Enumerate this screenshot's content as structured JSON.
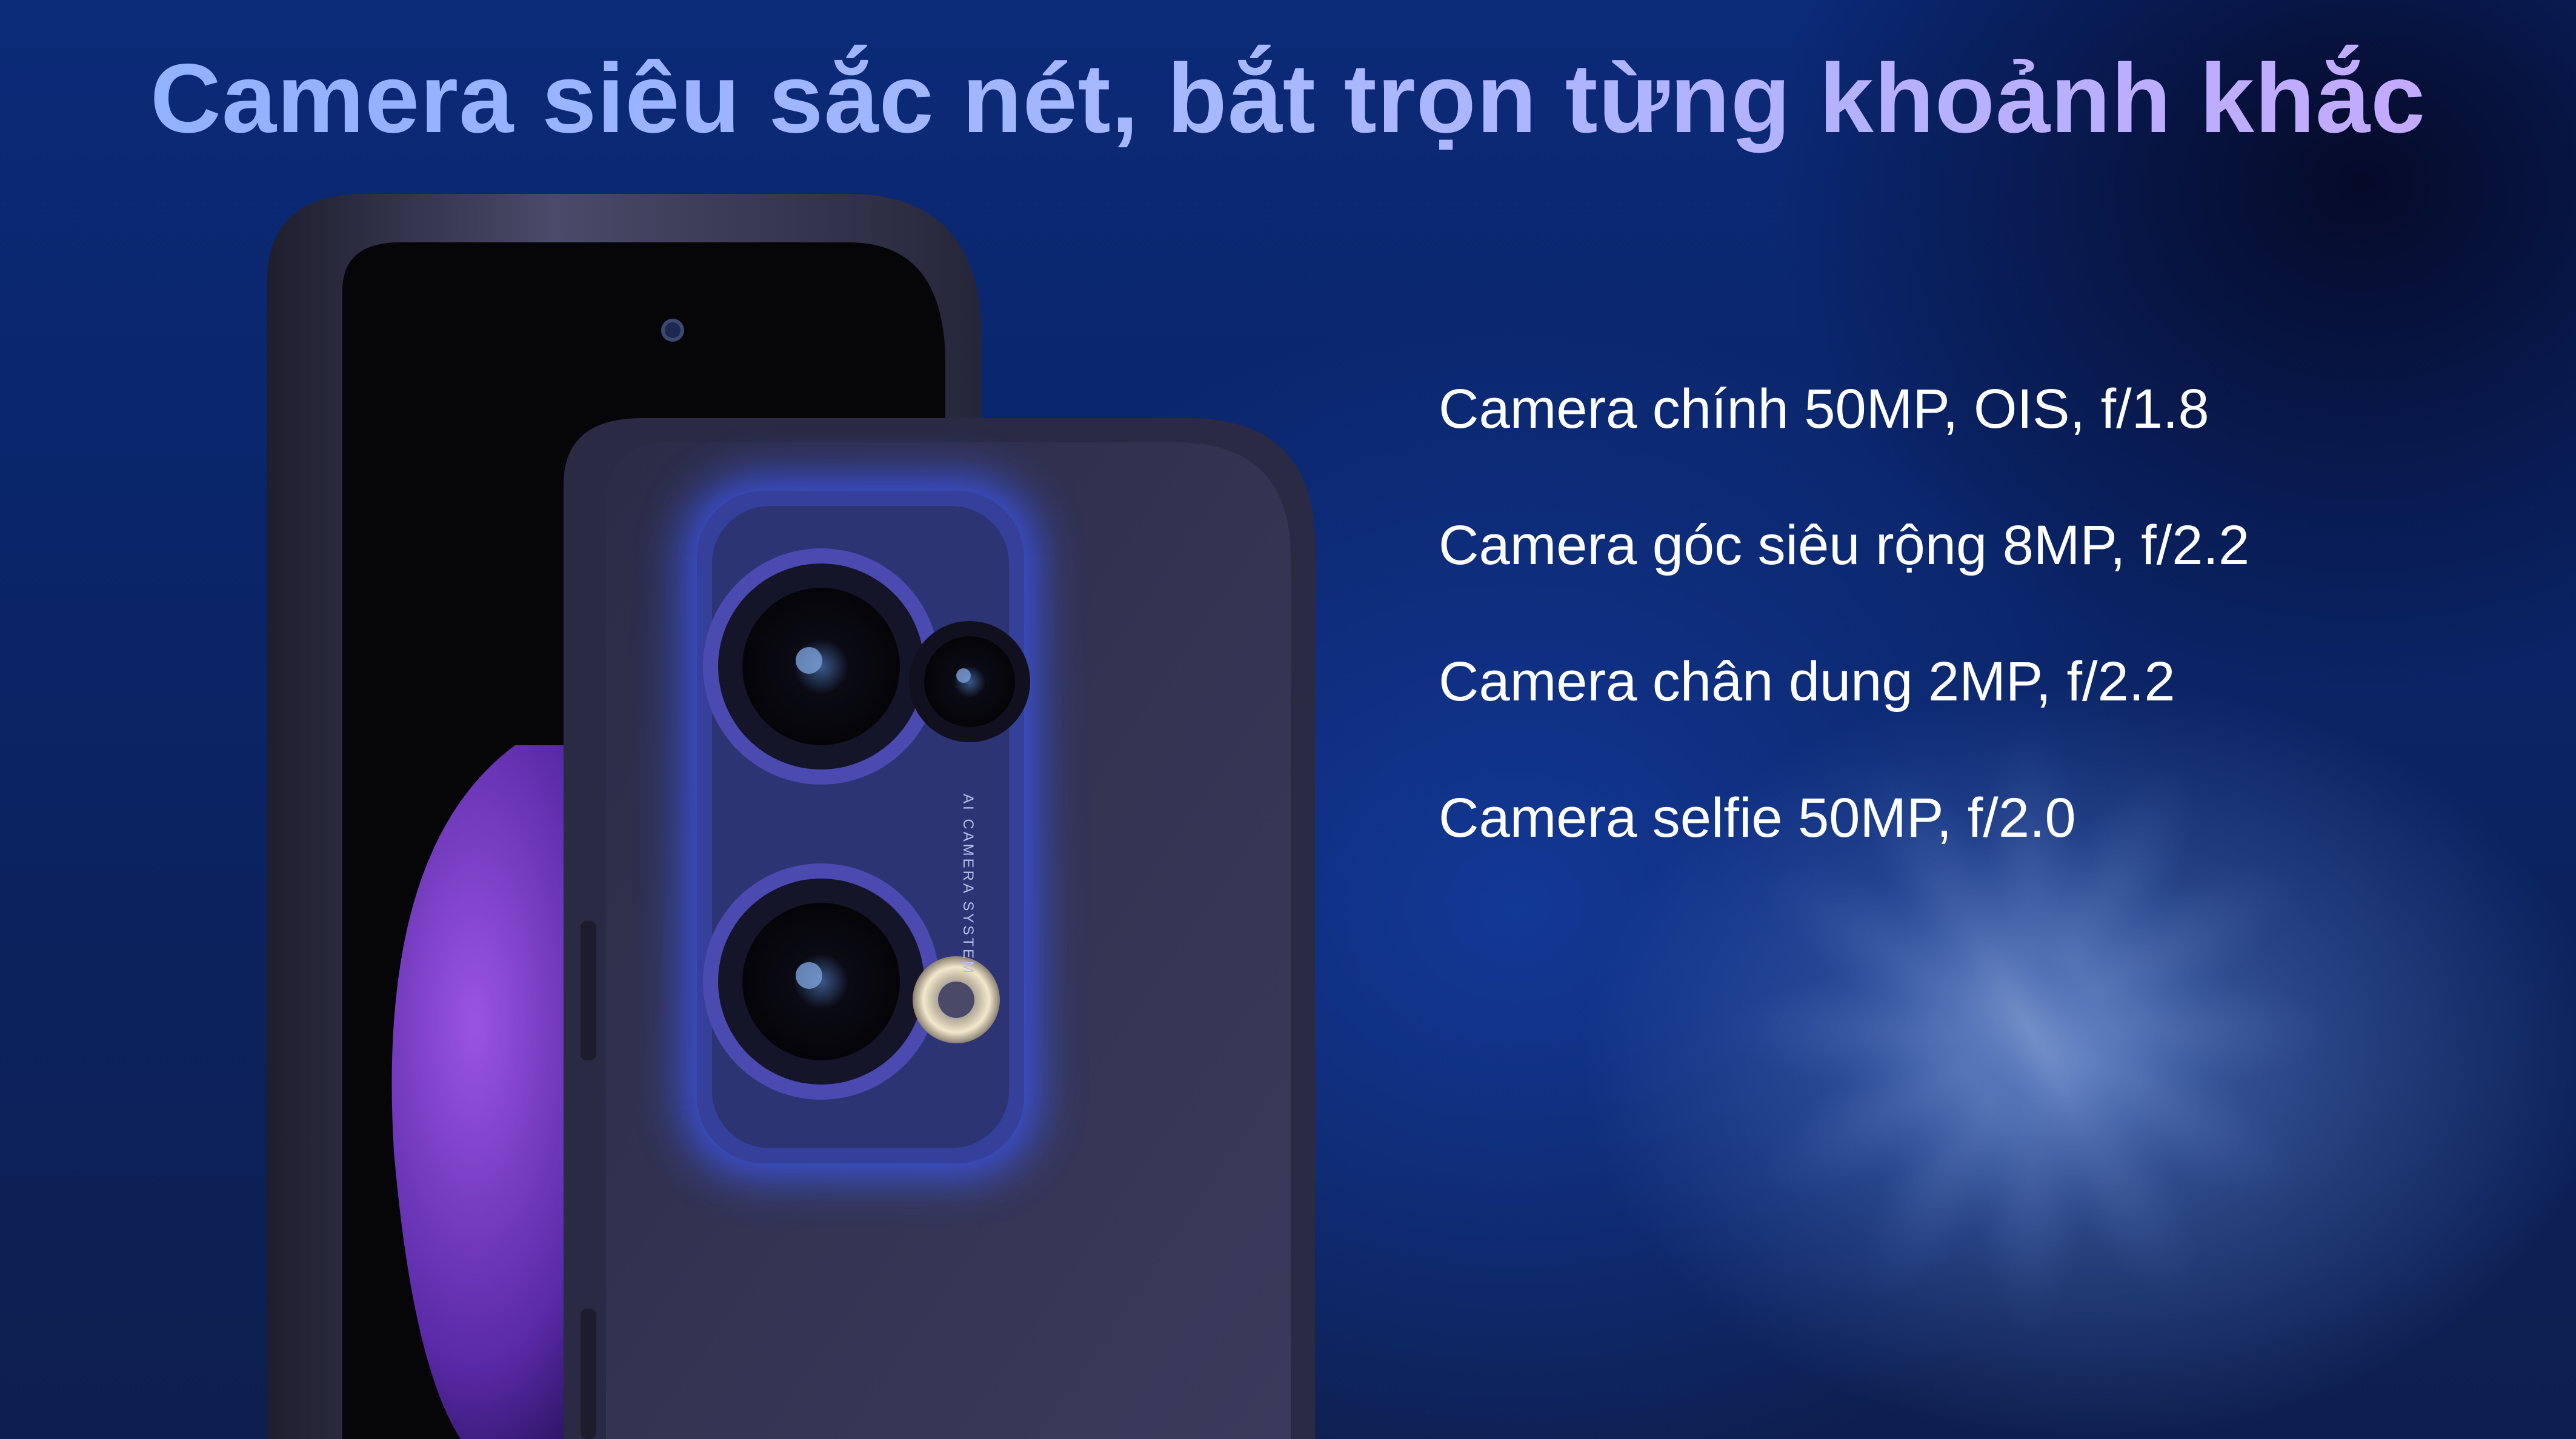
{
  "headline": "Camera siêu sắc nét, bắt trọn từng khoảnh khắc",
  "specs": [
    "Camera chính 50MP, OIS, f/1.8",
    "Camera góc siêu rộng 8MP, f/2.2",
    "Camera chân dung 2MP, f/2.2",
    "Camera selfie 50MP, f/2.0"
  ],
  "camera_module_text": "AI CAMERA SYSTEM",
  "colors": {
    "background_deep": "#0a2466",
    "headline_start": "#8fb0ff",
    "headline_end": "#c6a8ff",
    "phone_body": "#3a3a5c",
    "camera_glow": "#3d5cff",
    "spec_text": "#ffffff"
  }
}
